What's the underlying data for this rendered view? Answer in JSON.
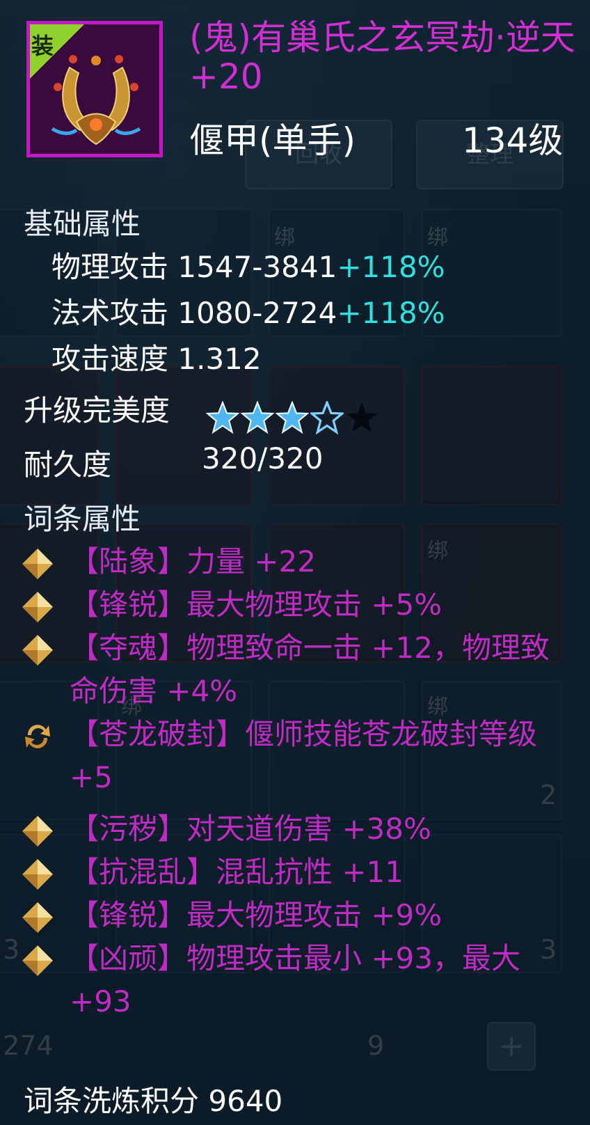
{
  "item": {
    "badge": "装",
    "name": "(鬼)有巢氏之玄冥劫·逆天 +20",
    "type": "偃甲(单手)",
    "level": "134级",
    "rarity_color": "#c417c6"
  },
  "basic_attributes": {
    "title": "基础属性",
    "physical_attack": {
      "label": "物理攻击",
      "value": "1547-3841",
      "bonus": "+118%"
    },
    "magic_attack": {
      "label": "法术攻击",
      "value": "1080-2724",
      "bonus": "+118%"
    },
    "attack_speed": {
      "label": "攻击速度",
      "value": "1.312"
    }
  },
  "perfection": {
    "label": "升级完美度",
    "rating": 3.5,
    "max": 4
  },
  "durability": {
    "label": "耐久度",
    "value": "320/320"
  },
  "affixes": {
    "title": "词条属性",
    "items": [
      {
        "icon": "diamond-icon",
        "text": "【陆象】力量 +22"
      },
      {
        "icon": "diamond-icon",
        "text": "【锋锐】最大物理攻击 +5%"
      },
      {
        "icon": "diamond-icon",
        "text": "【夺魂】物理致命一击 +12，物理致命伤害 +4%"
      },
      {
        "icon": "refresh-icon",
        "text": "【苍龙破封】偃师技能苍龙破封等级 +5"
      },
      {
        "icon": "diamond-icon",
        "text": "【污秽】对天道伤害 +38%"
      },
      {
        "icon": "diamond-icon",
        "text": "【抗混乱】混乱抗性 +11"
      },
      {
        "icon": "diamond-icon",
        "text": "【锋锐】最大物理攻击 +9%"
      },
      {
        "icon": "diamond-icon",
        "text": "【凶顽】物理攻击最小 +93，最大 +93"
      }
    ]
  },
  "refine_score": {
    "label": "词条洗炼积分",
    "value": "9640"
  },
  "background": {
    "buttons": [
      "回收",
      "整理"
    ],
    "bound_tag": "绑",
    "counts": [
      "2",
      "3",
      "3",
      "274",
      "9"
    ],
    "plus_label": "+"
  },
  "colors": {
    "name": "#d22fd3",
    "affix": "#c02bc4",
    "bonus": "#2fe0e0",
    "badge": "#8fd12e"
  }
}
